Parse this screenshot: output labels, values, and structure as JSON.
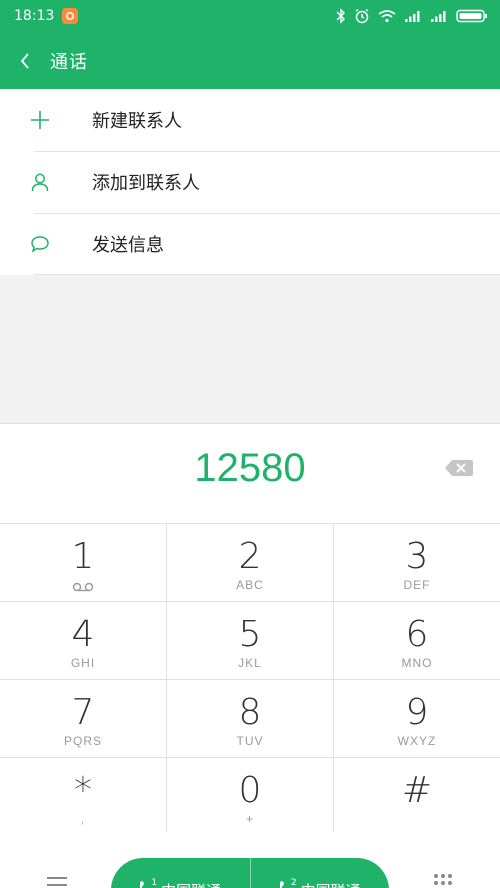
{
  "statusbar": {
    "time": "18:13",
    "icons": [
      "app-notification-icon",
      "bluetooth-icon",
      "alarm-icon",
      "wifi-icon",
      "signal-icon",
      "signal-icon",
      "battery-icon"
    ]
  },
  "header": {
    "title": "通话"
  },
  "options": [
    {
      "icon": "plus-icon",
      "label": "新建联系人"
    },
    {
      "icon": "person-icon",
      "label": "添加到联系人"
    },
    {
      "icon": "message-icon",
      "label": "发送信息"
    }
  ],
  "dialer": {
    "number": "12580",
    "keys": [
      {
        "digit": "1",
        "sub": "voicemail-icon"
      },
      {
        "digit": "2",
        "sub": "ABC"
      },
      {
        "digit": "3",
        "sub": "DEF"
      },
      {
        "digit": "4",
        "sub": "GHI"
      },
      {
        "digit": "5",
        "sub": "JKL"
      },
      {
        "digit": "6",
        "sub": "MNO"
      },
      {
        "digit": "7",
        "sub": "PQRS"
      },
      {
        "digit": "8",
        "sub": "TUV"
      },
      {
        "digit": "9",
        "sub": "WXYZ"
      },
      {
        "digit": "*",
        "sub": ","
      },
      {
        "digit": "0",
        "sub": "+"
      },
      {
        "digit": "#",
        "sub": ""
      }
    ]
  },
  "call_buttons": [
    {
      "sim": "1",
      "label": "中国联通"
    },
    {
      "sim": "2",
      "label": "中国联通"
    }
  ],
  "colors": {
    "accent": "#1fb36a",
    "text": "#222222",
    "subtext": "#9a9a9a",
    "divider": "#e0e0e0"
  }
}
